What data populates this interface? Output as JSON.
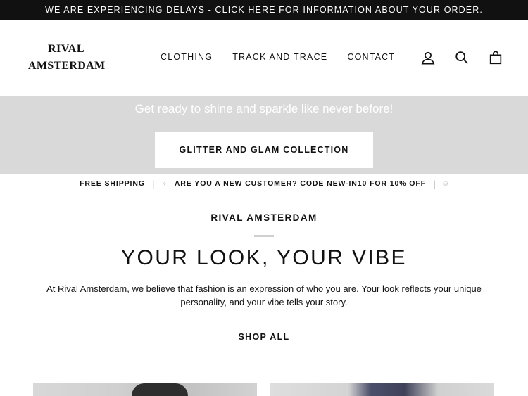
{
  "announcement": {
    "prefix": "WE ARE EXPERIENCING DELAYS - ",
    "link": "CLICK HERE",
    "suffix": " FOR INFORMATION ABOUT YOUR ORDER."
  },
  "logo": {
    "line1": "RIVAL",
    "line2": "AMSTERDAM"
  },
  "nav": [
    "CLOTHING",
    "TRACK AND TRACE",
    "CONTACT"
  ],
  "icons": [
    "account-icon",
    "search-icon",
    "cart-icon"
  ],
  "hero": {
    "tagline": "Get ready to shine and sparkle like never before!",
    "button": "GLITTER AND GLAM COLLECTION"
  },
  "usp": {
    "item1": "FREE SHIPPING",
    "item2": "ARE YOU A NEW CUSTOMER? CODE NEW-IN10 FOR 10% OFF"
  },
  "intro": {
    "brand": "RIVAL AMSTERDAM",
    "headline": "YOUR LOOK, YOUR VIBE",
    "description": "At Rival Amsterdam, we believe that fashion is an expression of who you are. Your look reflects your unique personality, and your vibe tells your story.",
    "cta": "SHOP ALL"
  },
  "colors": {
    "announcement_bg": "#111111",
    "hero_bg": "#d9d9d9",
    "text": "#111111"
  }
}
